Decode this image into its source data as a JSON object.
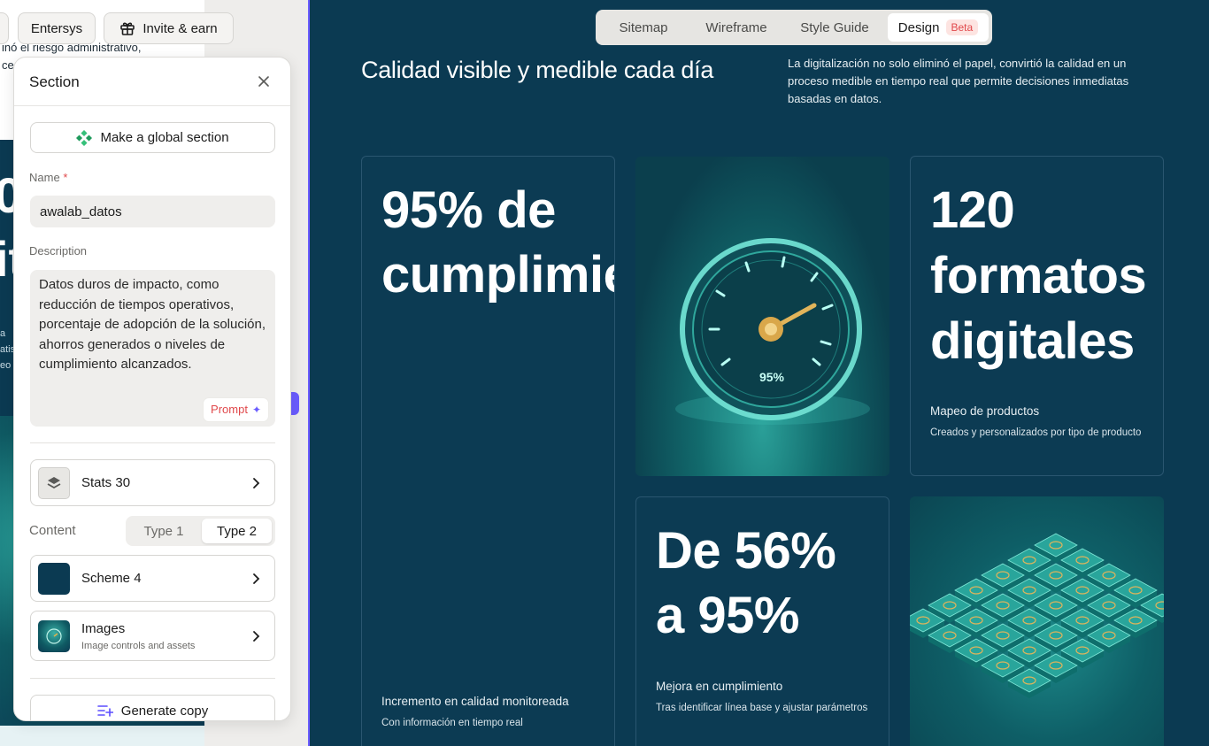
{
  "toolbar": {
    "entersys_label": "Entersys",
    "invite_label": "Invite & earn"
  },
  "background_preview": {
    "line1": "inó el riesgo administrativo,",
    "line2": "ce",
    "big_text": "0\nit",
    "small_text": "a\natis\neo"
  },
  "section_panel": {
    "title": "Section",
    "global_button": "Make a global section",
    "name_label": "Name",
    "name_required": "*",
    "name_value": "awalab_datos",
    "description_label": "Description",
    "description_value": "Datos duros de impacto, como reducción de tiempos operativos, porcentaje de adopción de la solución, ahorros generados o niveles de cumplimiento alcanzados.",
    "prompt_label": "Prompt",
    "stats_label": "Stats 30",
    "content_label": "Content",
    "content_options": [
      "Type 1",
      "Type 2"
    ],
    "content_selected": "Type 2",
    "scheme_label": "Scheme 4",
    "images_label": "Images",
    "images_sub": "Image controls and assets",
    "generate_label": "Generate copy"
  },
  "tabs": {
    "items": [
      "Sitemap",
      "Wireframe",
      "Style Guide",
      "Design"
    ],
    "active": "Design",
    "badge": "Beta"
  },
  "preview": {
    "heading": "Calidad visible y medible cada día",
    "intro": "La digitalización no solo eliminó el papel, convirtió la calidad en un proceso medible en tiempo real que permite decisiones inmediatas basadas en datos.",
    "gauge_readout": "95%",
    "cards": [
      {
        "stat": "95% de cumplimie",
        "label": "Incremento en calidad monitoreada",
        "sub": "Con información en tiempo real"
      },
      {
        "stat": "120 formatos digitales",
        "label": "Mapeo de productos",
        "sub": "Creados y personalizados por tipo de producto"
      },
      {
        "stat": "De 56% a 95%",
        "label": "Mejora en cumplimiento",
        "sub": "Tras identificar línea base y ajustar parámetros"
      }
    ]
  },
  "colors": {
    "preview_bg": "#0b3a52",
    "accent_purple": "#6a5cff",
    "required_red": "#e0484b",
    "teal_glow": "#2aa39c"
  }
}
